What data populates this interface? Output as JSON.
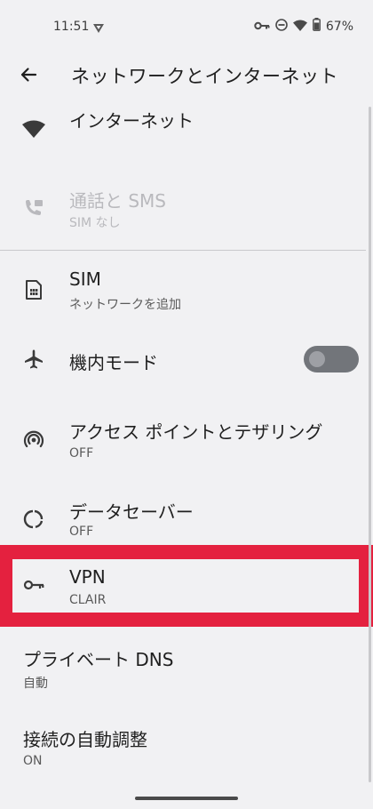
{
  "status_bar": {
    "time": "11:51",
    "battery_percent": "67%"
  },
  "app_bar": {
    "title": "ネットワークとインターネット"
  },
  "items": [
    {
      "title": "インターネット",
      "icon": "wifi-icon"
    },
    {
      "title": "通話と SMS",
      "subtitle": "SIM なし",
      "icon": "phone-sms-icon",
      "disabled": true
    },
    {
      "title": "SIM",
      "subtitle": "ネットワークを追加",
      "icon": "sim-card-icon"
    },
    {
      "title": "機内モード",
      "icon": "airplane-icon",
      "toggle": "off"
    },
    {
      "title": "アクセス ポイントとテザリング",
      "subtitle": "OFF",
      "icon": "hotspot-icon"
    },
    {
      "title": "データセーバー",
      "subtitle": "OFF",
      "icon": "data-saver-icon"
    },
    {
      "title": "VPN",
      "subtitle": "CLAIR",
      "icon": "key-icon",
      "highlighted": true
    },
    {
      "title": "プライベート DNS",
      "subtitle": "自動"
    },
    {
      "title": "接続の自動調整",
      "subtitle": "ON"
    }
  ],
  "colors": {
    "background": "#f1f1f3",
    "highlight_border": "#e4213f",
    "toggle_track": "#72757a"
  }
}
